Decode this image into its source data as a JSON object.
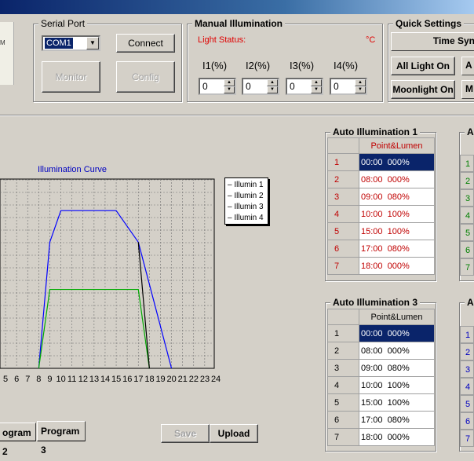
{
  "sidebar_edge": {
    "text": "M"
  },
  "serial": {
    "legend": "Serial Port",
    "port": "COM1",
    "connect": "Connect",
    "monitor": "Monitor",
    "config": "Config"
  },
  "manual": {
    "legend": "Manual Illumination",
    "light_status": "Light Status:",
    "temp_unit": "°C",
    "channels": [
      {
        "label": "I1(%)",
        "value": "0"
      },
      {
        "label": "I2(%)",
        "value": "0"
      },
      {
        "label": "I3(%)",
        "value": "0"
      },
      {
        "label": "I4(%)",
        "value": "0"
      }
    ]
  },
  "quick": {
    "legend": "Quick Settings",
    "time_sync": "Time Syn",
    "all_light_on": "All Light On",
    "moonlight_on": "Moonlight On",
    "edge_a": "A",
    "edge_m": "M"
  },
  "chart_data": {
    "type": "line",
    "title": "Illumination Curve",
    "x_ticks": [
      "5",
      "6",
      "7",
      "8",
      "9",
      "10",
      "11",
      "12",
      "13",
      "14",
      "15",
      "16",
      "17",
      "18",
      "19",
      "20",
      "21",
      "22",
      "23",
      "24"
    ],
    "xlim": [
      0,
      24
    ],
    "ylim": [
      0,
      120
    ],
    "grid": true,
    "legend_position": "top-right",
    "series": [
      {
        "name": "Illumin 1",
        "color": "#0000ff",
        "x": [
          8,
          9,
          10,
          15,
          17,
          20
        ],
        "y": [
          0,
          80,
          100,
          100,
          80,
          0
        ]
      },
      {
        "name": "Illumin 2",
        "color": "#00aa00",
        "x": [
          8,
          9,
          10,
          17,
          18
        ],
        "y": [
          0,
          50,
          50,
          50,
          0
        ]
      },
      {
        "name": "Illumin 3",
        "color": "#000000",
        "x": [
          17,
          18
        ],
        "y": [
          80,
          0
        ]
      },
      {
        "name": "Illumin 4",
        "color": "#000000",
        "x": [],
        "y": []
      }
    ]
  },
  "auto1": {
    "legend": "Auto Illumination 1",
    "header": "Point&Lumen",
    "rows": [
      {
        "idx": "1",
        "value": "00:00  000%"
      },
      {
        "idx": "2",
        "value": "08:00  000%"
      },
      {
        "idx": "3",
        "value": "09:00  080%"
      },
      {
        "idx": "4",
        "value": "10:00  100%"
      },
      {
        "idx": "5",
        "value": "15:00  100%"
      },
      {
        "idx": "6",
        "value": "17:00  080%"
      },
      {
        "idx": "7",
        "value": "18:00  000%"
      }
    ]
  },
  "auto3": {
    "legend": "Auto Illumination 3",
    "header": "Point&Lumen",
    "rows": [
      {
        "idx": "1",
        "value": "00:00  000%"
      },
      {
        "idx": "2",
        "value": "08:00  000%"
      },
      {
        "idx": "3",
        "value": "09:00  080%"
      },
      {
        "idx": "4",
        "value": "10:00  100%"
      },
      {
        "idx": "5",
        "value": "15:00  100%"
      },
      {
        "idx": "6",
        "value": "17:00  080%"
      },
      {
        "idx": "7",
        "value": "18:00  000%"
      }
    ]
  },
  "edge_tables": {
    "legend_top": "Au",
    "legend_bottom": "Au",
    "idx": [
      "1",
      "2",
      "3",
      "4",
      "5",
      "6",
      "7"
    ]
  },
  "tabs": {
    "program2": "ogram 2",
    "program3": "Program 3"
  },
  "actions": {
    "save": "Save",
    "upload": "Upload"
  }
}
